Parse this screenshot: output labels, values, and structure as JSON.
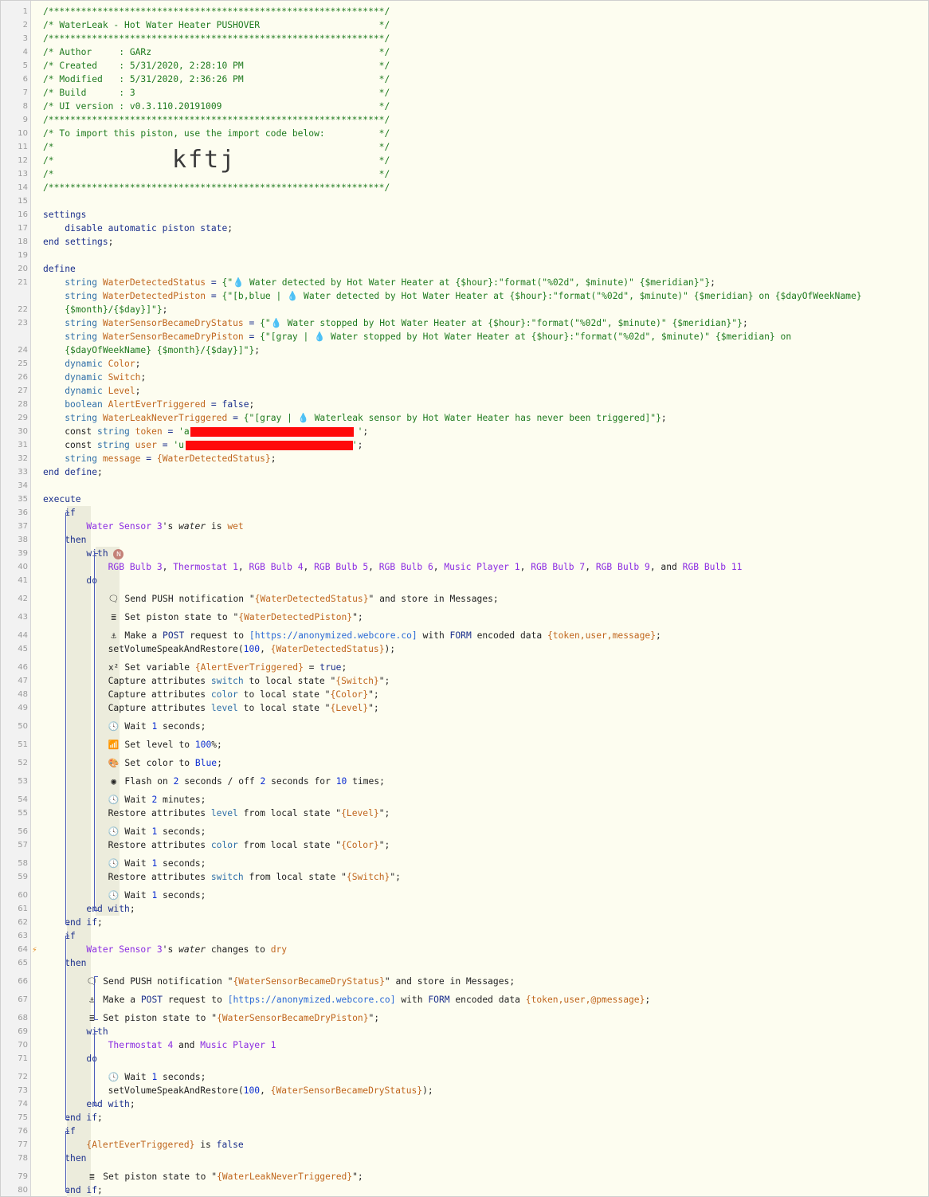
{
  "import_code": "kftj",
  "lines": [
    {
      "n": "1",
      "h": "<span class='cm'>/**************************************************************/</span>"
    },
    {
      "n": "2",
      "h": "<span class='cm'>/* WaterLeak - Hot Water Heater PUSHOVER                      */</span>"
    },
    {
      "n": "3",
      "h": "<span class='cm'>/**************************************************************/</span>"
    },
    {
      "n": "4",
      "h": "<span class='cm'>/* Author     : GARz                                          */</span>"
    },
    {
      "n": "5",
      "h": "<span class='cm'>/* Created    : 5/31/2020, 2:28:10 PM                         */</span>"
    },
    {
      "n": "6",
      "h": "<span class='cm'>/* Modified   : 5/31/2020, 2:36:26 PM                         */</span>"
    },
    {
      "n": "7",
      "h": "<span class='cm'>/* Build      : 3                                             */</span>"
    },
    {
      "n": "8",
      "h": "<span class='cm'>/* UI version : v0.3.110.20191009                             */</span>"
    },
    {
      "n": "9",
      "h": "<span class='cm'>/**************************************************************/</span>"
    },
    {
      "n": "10",
      "h": "<span class='cm'>/* To import this piston, use the import code below:          */</span>"
    },
    {
      "n": "11",
      "h": "<span class='cm'>/*                                                            */</span>"
    },
    {
      "n": "12",
      "h": "<span class='cm'>/*                                                            */</span>"
    },
    {
      "n": "13",
      "h": "<span class='cm'>/*                                                            */</span>"
    },
    {
      "n": "14",
      "h": "<span class='cm'>/**************************************************************/</span>"
    },
    {
      "n": "15",
      "h": ""
    },
    {
      "n": "16",
      "h": "<span class='kw'>settings</span>"
    },
    {
      "n": "17",
      "h": "    <span class='kw'>disable automatic piston state</span><span class='tx'>;</span>"
    },
    {
      "n": "18",
      "h": "<span class='kw'>end settings</span><span class='tx'>;</span>"
    },
    {
      "n": "19",
      "h": ""
    },
    {
      "n": "20",
      "h": "<span class='kw'>define</span>"
    },
    {
      "n": "21",
      "h": "    <span class='ty'>string</span> <span class='vr'>WaterDetectedStatus</span> <span class='op'>=</span> <span class='st'>{\"<span class='drop'>💧</span> Water detected by Hot Water Heater at {$hour}:\"format(\"%02d\", $minute)\" {$meridian}\"}</span><span class='tx'>;</span>"
    },
    {
      "n": "22",
      "h": "    <span class='ty'>string</span> <span class='vr'>WaterDetectedPiston</span> <span class='op'>=</span> <span class='st'>{\"[b,blue | <span class='drop'>💧</span> Water detected by Hot Water Heater at {$hour}:\"format(\"%02d\", $minute)\" {$meridian} on {$dayOfWeekName}</span>",
      "h2": "    <span class='st'>{$month}/{$day}]\"}</span><span class='tx'>;</span>",
      "wrap": true
    },
    {
      "n": "23",
      "h": "    <span class='ty'>string</span> <span class='vr'>WaterSensorBecameDryStatus</span> <span class='op'>=</span> <span class='st'>{\"<span class='drop'>💧</span> Water stopped by Hot Water Heater at {$hour}:\"format(\"%02d\", $minute)\" {$meridian}\"}</span><span class='tx'>;</span>"
    },
    {
      "n": "24",
      "h": "    <span class='ty'>string</span> <span class='vr'>WaterSensorBecameDryPiston</span> <span class='op'>=</span> <span class='st'>{\"[gray | <span class='drop'>💧</span> Water stopped by Hot Water Heater at {$hour}:\"format(\"%02d\", $minute)\" {$meridian} on</span>",
      "h2": "    <span class='st'>{$dayOfWeekName} {$month}/{$day}]\"}</span><span class='tx'>;</span>",
      "wrap": true
    },
    {
      "n": "25",
      "h": "    <span class='ty'>dynamic</span> <span class='vr'>Color</span><span class='tx'>;</span>"
    },
    {
      "n": "26",
      "h": "    <span class='ty'>dynamic</span> <span class='vr'>Switch</span><span class='tx'>;</span>"
    },
    {
      "n": "27",
      "h": "    <span class='ty'>dynamic</span> <span class='vr'>Level</span><span class='tx'>;</span>"
    },
    {
      "n": "28",
      "h": "    <span class='ty'>boolean</span> <span class='vr'>AlertEverTriggered</span> <span class='op'>=</span> <span class='kw'>false</span><span class='tx'>;</span>"
    },
    {
      "n": "29",
      "h": "    <span class='ty'>string</span> <span class='vr'>WaterLeakNeverTriggered</span> <span class='op'>=</span> <span class='st'>{\"[gray | <span class='drop'>💧</span> Waterleak sensor by Hot Water Heater has never been triggered]\"}</span><span class='tx'>;</span>"
    },
    {
      "n": "30",
      "h": "    <span class='tx'>const</span> <span class='ty'>string</span> <span class='vr'>token</span> <span class='op'>=</span> <span class='st'>'a                               '</span><span class='tx'>;</span>"
    },
    {
      "n": "31",
      "h": "    <span class='tx'>const</span> <span class='ty'>string</span> <span class='vr'>user</span> <span class='op'>=</span> <span class='st'>'u                               '</span><span class='tx'>;</span>"
    },
    {
      "n": "32",
      "h": "    <span class='ty'>string</span> <span class='vr'>message</span> <span class='op'>=</span> <span class='vr'>{WaterDetectedStatus}</span><span class='tx'>;</span>"
    },
    {
      "n": "33",
      "h": "<span class='kw'>end define</span><span class='tx'>;</span>"
    },
    {
      "n": "34",
      "h": ""
    },
    {
      "n": "35",
      "h": "<span class='kw'>execute</span>"
    },
    {
      "n": "36",
      "h": "    <span class='kw'>if</span>"
    },
    {
      "n": "37",
      "h": "        <span class='dv'>Water Sensor 3</span><span class='tx'>'s</span> <span class='tx'><i>water</i></span> <span class='tx'>is</span> <span class='vr'>wet</span>"
    },
    {
      "n": "38",
      "h": "    <span class='kw'>then</span>"
    },
    {
      "n": "39",
      "h": "        <span class='kw'>with</span> <span class='badge'>N</span>"
    },
    {
      "n": "40",
      "h": "            <span class='dv'>RGB Bulb 3</span>, <span class='dv'>Thermostat 1</span>, <span class='dv'>RGB Bulb 4</span>, <span class='dv'>RGB Bulb 5</span>, <span class='dv'>RGB Bulb 6</span>, <span class='dv'>Music Player 1</span>, <span class='dv'>RGB Bulb 7</span>, <span class='dv'>RGB Bulb 9</span>, and <span class='dv'>RGB Bulb 11</span>"
    },
    {
      "n": "41",
      "h": "        <span class='kw'>do</span>"
    },
    {
      "n": "42",
      "h": "            <span class='icon'>🗨</span> Send PUSH notification \"<span class='vr'>{WaterDetectedStatus}</span>\" and store in Messages;",
      "tall": true
    },
    {
      "n": "43",
      "h": "            <span class='icon'>≣</span> Set piston state to \"<span class='vr'>{WaterDetectedPiston}</span>\";",
      "tall": true
    },
    {
      "n": "44",
      "h": "            <span class='icon'>⚓</span> Make a <span class='kw'>POST</span> request to <span class='url'>[https://anonymized.webcore.co]</span> with <span class='kw'>FORM</span> encoded data <span class='vr'>{token,user,message}</span>;",
      "tall": true
    },
    {
      "n": "45",
      "h": "            setVolumeSpeakAndRestore(<span class='nm'>100</span>, <span class='vr'>{WaterDetectedStatus}</span>);"
    },
    {
      "n": "46",
      "h": "            <span class='icon'>x²</span> Set variable <span class='vr'>{AlertEverTriggered}</span> = <span class='kw'>true</span>;",
      "tall": true
    },
    {
      "n": "47",
      "h": "            Capture attributes <span class='ty'>switch</span> to local state \"<span class='vr'>{Switch}</span>\";"
    },
    {
      "n": "48",
      "h": "            Capture attributes <span class='ty'>color</span> to local state \"<span class='vr'>{Color}</span>\";"
    },
    {
      "n": "49",
      "h": "            Capture attributes <span class='ty'>level</span> to local state \"<span class='vr'>{Level}</span>\";"
    },
    {
      "n": "50",
      "h": "            <span class='icon'>🕓</span> Wait <span class='nm'>1</span> seconds;",
      "tall": true
    },
    {
      "n": "51",
      "h": "            <span class='icon'>📶</span> Set level to <span class='nm'>100</span>%;",
      "tall": true
    },
    {
      "n": "52",
      "h": "            <span class='icon'>🎨</span> Set color to <span class='nm'>Blue</span>;",
      "tall": true
    },
    {
      "n": "53",
      "h": "            <span class='icon'>◉</span> Flash on <span class='nm'>2</span> seconds / off <span class='nm'>2</span> seconds for <span class='nm'>10</span> times;",
      "tall": true
    },
    {
      "n": "54",
      "h": "            <span class='icon'>🕓</span> Wait <span class='nm'>2</span> minutes;",
      "tall": true
    },
    {
      "n": "55",
      "h": "            Restore attributes <span class='ty'>level</span> from local state \"<span class='vr'>{Level}</span>\";"
    },
    {
      "n": "56",
      "h": "            <span class='icon'>🕓</span> Wait <span class='nm'>1</span> seconds;",
      "tall": true
    },
    {
      "n": "57",
      "h": "            Restore attributes <span class='ty'>color</span> from local state \"<span class='vr'>{Color}</span>\";"
    },
    {
      "n": "58",
      "h": "            <span class='icon'>🕓</span> Wait <span class='nm'>1</span> seconds;",
      "tall": true
    },
    {
      "n": "59",
      "h": "            Restore attributes <span class='ty'>switch</span> from local state \"<span class='vr'>{Switch}</span>\";"
    },
    {
      "n": "60",
      "h": "            <span class='icon'>🕓</span> Wait <span class='nm'>1</span> seconds;",
      "tall": true
    },
    {
      "n": "61",
      "h": "        <span class='kw'>end with</span>;"
    },
    {
      "n": "62",
      "h": "    <span class='kw'>end if</span>;"
    },
    {
      "n": "63",
      "h": "    <span class='kw'>if</span>"
    },
    {
      "n": "64",
      "h": "        <span class='dv'>Water Sensor 3</span><span class='tx'>'s</span> <i>water</i> changes to <span class='vr'>dry</span>",
      "bolt": true
    },
    {
      "n": "65",
      "h": "    <span class='kw'>then</span>"
    },
    {
      "n": "66",
      "h": "        <span class='icon'>🗨</span> Send PUSH notification \"<span class='vr'>{WaterSensorBecameDryStatus}</span>\" and store in Messages;",
      "tall": true
    },
    {
      "n": "67",
      "h": "        <span class='icon'>⚓</span> Make a <span class='kw'>POST</span> request to <span class='url'>[https://anonymized.webcore.co]</span> with <span class='kw'>FORM</span> encoded data <span class='vr'>{token,user,@pmessage}</span>;",
      "tall": true
    },
    {
      "n": "68",
      "h": "        <span class='icon'>≣</span> Set piston state to \"<span class='vr'>{WaterSensorBecameDryPiston}</span>\";",
      "tall": true
    },
    {
      "n": "69",
      "h": "        <span class='kw'>with</span>"
    },
    {
      "n": "70",
      "h": "            <span class='dv'>Thermostat 4</span> and <span class='dv'>Music Player 1</span>"
    },
    {
      "n": "71",
      "h": "        <span class='kw'>do</span>"
    },
    {
      "n": "72",
      "h": "            <span class='icon'>🕓</span> Wait <span class='nm'>1</span> seconds;",
      "tall": true
    },
    {
      "n": "73",
      "h": "            setVolumeSpeakAndRestore(<span class='nm'>100</span>, <span class='vr'>{WaterSensorBecameDryStatus}</span>);"
    },
    {
      "n": "74",
      "h": "        <span class='kw'>end with</span>;"
    },
    {
      "n": "75",
      "h": "    <span class='kw'>end if</span>;"
    },
    {
      "n": "76",
      "h": "    <span class='kw'>if</span>"
    },
    {
      "n": "77",
      "h": "        <span class='vr'>{AlertEverTriggered}</span> is <span class='kw'>false</span>"
    },
    {
      "n": "78",
      "h": "    <span class='kw'>then</span>"
    },
    {
      "n": "79",
      "h": "        <span class='icon'>≣</span> Set piston state to \"<span class='vr'>{WaterLeakNeverTriggered}</span>\";",
      "tall": true
    },
    {
      "n": "80",
      "h": "    <span class='kw'>end if</span>;"
    }
  ]
}
